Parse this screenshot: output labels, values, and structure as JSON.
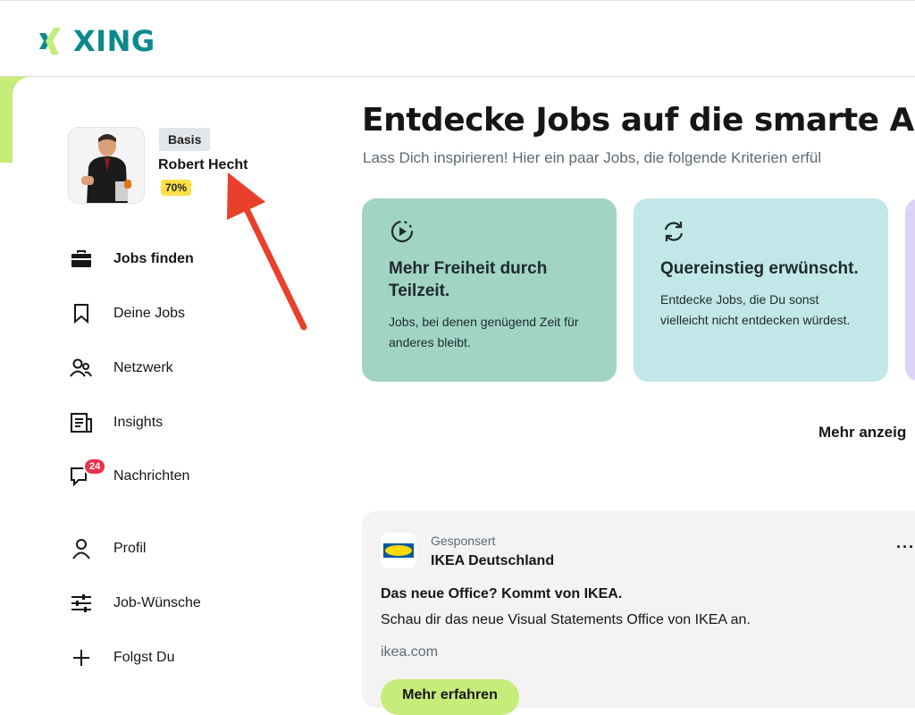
{
  "app": {
    "brand": "XING"
  },
  "profile": {
    "membership": "Basis",
    "name": "Robert Hecht",
    "completion": "70%"
  },
  "sidebar": {
    "items": [
      {
        "label": "Jobs finden",
        "icon": "briefcase-icon",
        "active": true
      },
      {
        "label": "Deine Jobs",
        "icon": "bookmark-icon"
      },
      {
        "label": "Netzwerk",
        "icon": "people-icon"
      },
      {
        "label": "Insights",
        "icon": "newspaper-icon"
      },
      {
        "label": "Nachrichten",
        "icon": "chat-icon",
        "badge": "24"
      },
      {
        "label": "Profil",
        "icon": "person-icon"
      },
      {
        "label": "Job-Wünsche",
        "icon": "sliders-icon"
      },
      {
        "label": "Folgst Du",
        "icon": "plus-icon"
      }
    ]
  },
  "main": {
    "heading": "Entdecke Jobs auf die smarte Art",
    "subheading": "Lass Dich inspirieren! Hier ein paar Jobs, die folgende Kriterien erfül",
    "cards": [
      {
        "title": "Mehr Freiheit durch Teilzeit.",
        "description": "Jobs, bei denen genügend Zeit für anderes bleibt.",
        "icon": "clock-play-icon",
        "color": "#a1d4c5"
      },
      {
        "title": "Quereinstieg erwünscht.",
        "description": "Entdecke Jobs, die Du sonst vielleicht nicht entdecken würdest.",
        "icon": "refresh-icon",
        "color": "#c2e7e8"
      }
    ],
    "more_link": "Mehr anzeig"
  },
  "ad": {
    "sponsored": "Gesponsert",
    "company": "IKEA Deutschland",
    "logo_text": "IKEA",
    "headline": "Das neue Office? Kommt von IKEA.",
    "text": "Schau dir das neue Visual Statements Office von IKEA an.",
    "url": "ikea.com",
    "button": "Mehr erfahren",
    "menu": "···"
  },
  "colors": {
    "brand": "#0a8a8d",
    "lime": "#c6ec7a",
    "arrow": "#e8402a",
    "badge": "#e8334a"
  }
}
